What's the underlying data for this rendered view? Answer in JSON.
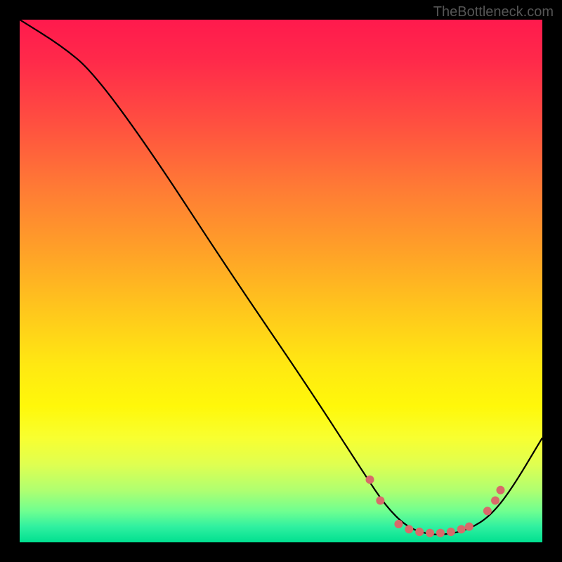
{
  "watermark": "TheBottleneck.com",
  "chart_data": {
    "type": "line",
    "title": "",
    "xlabel": "",
    "ylabel": "",
    "x_range": [
      0,
      100
    ],
    "y_range": [
      0,
      100
    ],
    "curve": [
      {
        "x": 0,
        "y": 100
      },
      {
        "x": 8,
        "y": 95
      },
      {
        "x": 14,
        "y": 90
      },
      {
        "x": 25,
        "y": 75
      },
      {
        "x": 40,
        "y": 52
      },
      {
        "x": 55,
        "y": 30
      },
      {
        "x": 66,
        "y": 13
      },
      {
        "x": 70,
        "y": 7
      },
      {
        "x": 74,
        "y": 3
      },
      {
        "x": 78,
        "y": 1.5
      },
      {
        "x": 82,
        "y": 1.5
      },
      {
        "x": 86,
        "y": 2.5
      },
      {
        "x": 90,
        "y": 5
      },
      {
        "x": 94,
        "y": 10
      },
      {
        "x": 100,
        "y": 20
      }
    ],
    "markers": [
      {
        "x": 67,
        "y": 12
      },
      {
        "x": 69,
        "y": 8
      },
      {
        "x": 72.5,
        "y": 3.5
      },
      {
        "x": 74.5,
        "y": 2.5
      },
      {
        "x": 76.5,
        "y": 2
      },
      {
        "x": 78.5,
        "y": 1.8
      },
      {
        "x": 80.5,
        "y": 1.8
      },
      {
        "x": 82.5,
        "y": 2
      },
      {
        "x": 84.5,
        "y": 2.5
      },
      {
        "x": 86,
        "y": 3
      },
      {
        "x": 89.5,
        "y": 6
      },
      {
        "x": 91,
        "y": 8
      },
      {
        "x": 92,
        "y": 10
      }
    ],
    "marker_color": "#d86a6a",
    "background": "rainbow-vertical-gradient"
  }
}
